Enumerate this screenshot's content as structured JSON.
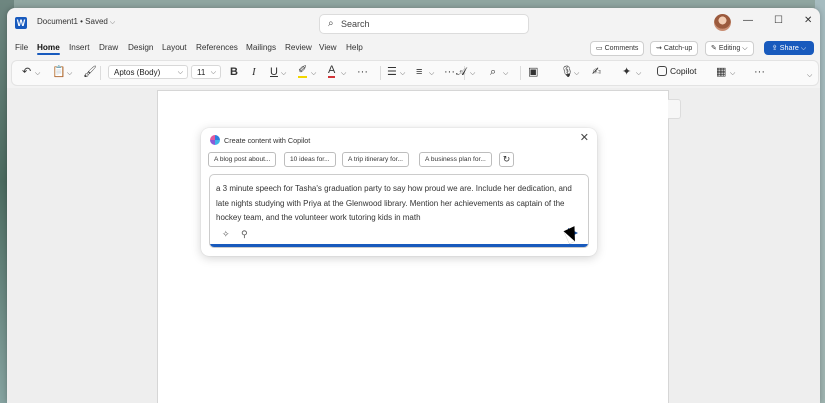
{
  "titlebar": {
    "app_icon": "word-icon",
    "doc_title": "Document1 • Saved",
    "search_placeholder": "Search",
    "controls": {
      "minimize": "—",
      "maximize": "☐",
      "close": "✕"
    }
  },
  "menu": {
    "tabs": [
      "File",
      "Home",
      "Insert",
      "Draw",
      "Design",
      "Layout",
      "References",
      "Mailings",
      "Review",
      "View",
      "Help"
    ],
    "active_tab": "Home",
    "right_buttons": {
      "comments": "Comments",
      "catchup": "Catch-up",
      "editing": "Editing",
      "share": "Share"
    }
  },
  "ribbon": {
    "font_name": "Aptos (Body)",
    "font_size": "11",
    "bold": "B",
    "italic": "I",
    "underline": "U",
    "font_color": "A",
    "copilot": "Copilot"
  },
  "copilot_dialog": {
    "title": "Create content with Copilot",
    "suggestions": [
      "A blog post about...",
      "10 ideas for...",
      "A trip itinerary for...",
      "A business plan for..."
    ],
    "prompt": "a 3 minute speech for Tasha's graduation party to say how proud we are. Include her dedication, and late nights studying with Priya at the Glenwood library. Mention her achievements as captain of the hockey team, and the volunteer work tutoring kids in math"
  },
  "colors": {
    "accent": "#185abd",
    "page": "#ffffff",
    "canvas": "#eeeeee"
  }
}
